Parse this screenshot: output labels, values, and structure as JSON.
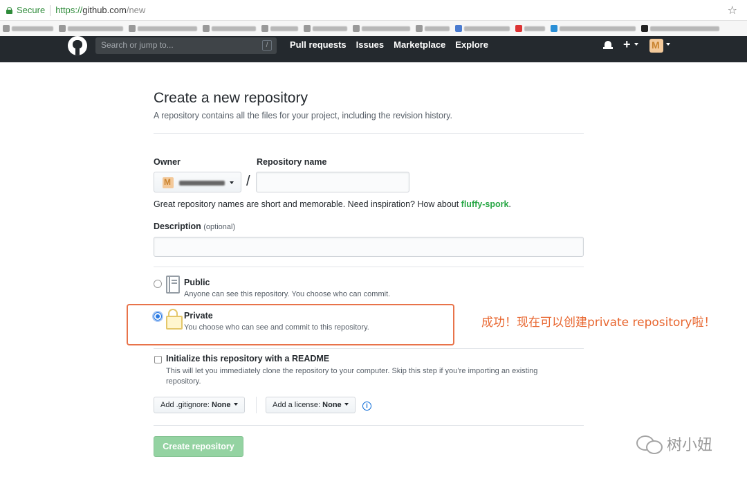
{
  "browser": {
    "secure_label": "Secure",
    "url_scheme": "https://",
    "url_host": "github.com",
    "url_path": "/new"
  },
  "header": {
    "search_placeholder": "Search or jump to...",
    "search_shortcut": "/",
    "nav": [
      "Pull requests",
      "Issues",
      "Marketplace",
      "Explore"
    ],
    "plus_label": "+"
  },
  "page": {
    "title": "Create a new repository",
    "subtitle": "A repository contains all the files for your project, including the revision history."
  },
  "form": {
    "owner_label": "Owner",
    "repo_name_label": "Repository name",
    "slash": "/",
    "hint_text": "Great repository names are short and memorable. Need inspiration? How about ",
    "hint_suggestion": "fluffy-spork",
    "hint_end": ".",
    "description_label": "Description",
    "description_optional": "(optional)",
    "public_title": "Public",
    "public_desc": "Anyone can see this repository. You choose who can commit.",
    "private_title": "Private",
    "private_desc": "You choose who can see and commit to this repository.",
    "readme_title": "Initialize this repository with a README",
    "readme_desc": "This will let you immediately clone the repository to your computer. Skip this step if you’re importing an existing repository.",
    "gitignore_prefix": "Add .gitignore: ",
    "gitignore_value": "None",
    "license_prefix": "Add a license: ",
    "license_value": "None",
    "info_glyph": "i",
    "create_button": "Create repository",
    "selected_visibility": "private"
  },
  "annotation": {
    "text": "成功！现在可以创建private repository啦！",
    "color": "#e8662f"
  },
  "watermark": {
    "text": "树小妞"
  },
  "colors": {
    "header_bg": "#24292e",
    "suggestion_green": "#28a745",
    "create_button_bg": "#94d3a2"
  }
}
